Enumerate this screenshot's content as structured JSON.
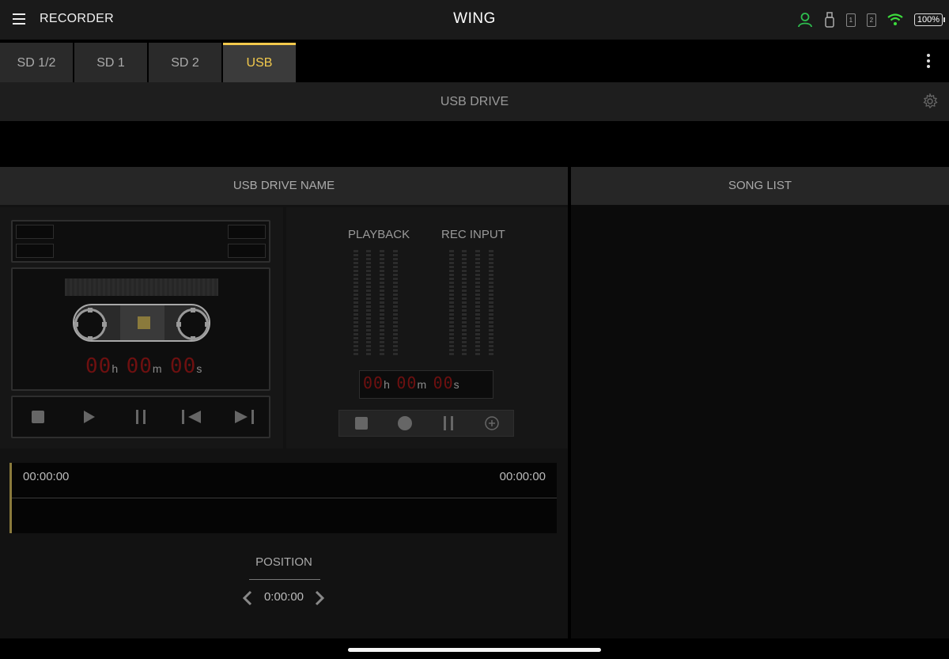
{
  "header": {
    "app_title": "RECORDER",
    "brand": "WING",
    "battery": "100%",
    "sd_slots": [
      "1",
      "2"
    ],
    "user_color": "#2ebd4e",
    "wifi_color": "#3ddc3d"
  },
  "tabs": [
    {
      "label": "SD 1/2",
      "active": false
    },
    {
      "label": "SD 1",
      "active": false
    },
    {
      "label": "SD 2",
      "active": false
    },
    {
      "label": "USB",
      "active": true
    }
  ],
  "section": {
    "title": "USB DRIVE"
  },
  "drive": {
    "name_header": "USB DRIVE NAME"
  },
  "songlist": {
    "header": "SONG LIST"
  },
  "cassette": {
    "time": {
      "h": "00",
      "m": "00",
      "s": "00",
      "h_unit": "h",
      "m_unit": "m",
      "s_unit": "s"
    }
  },
  "meters": {
    "playback_label": "PLAYBACK",
    "rec_input_label": "REC INPUT",
    "rec_time": {
      "h": "00",
      "m": "00",
      "s": "00",
      "h_unit": "h",
      "m_unit": "m",
      "s_unit": "s"
    }
  },
  "timeline": {
    "start": "00:00:00",
    "end": "00:00:00"
  },
  "position": {
    "label": "POSITION",
    "value": "0:00:00"
  },
  "colors": {
    "accent": "#f2c94c",
    "led": "#6e1010"
  }
}
